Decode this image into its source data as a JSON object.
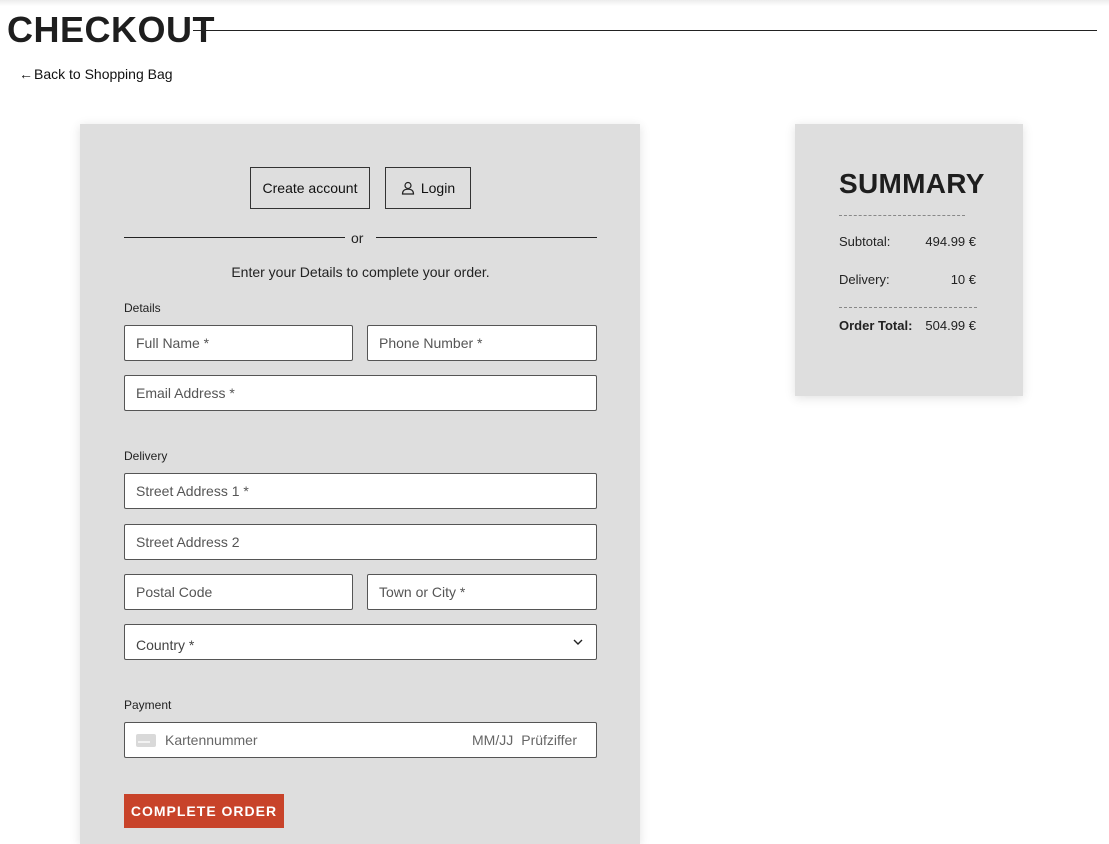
{
  "page": {
    "title": "CHECKOUT",
    "back_link": "Back to Shopping Bag",
    "back_arrow": "←"
  },
  "auth": {
    "create_account": "Create account",
    "login": "Login",
    "or": "or"
  },
  "form": {
    "intro": "Enter your Details to complete your order.",
    "details_label": "Details",
    "full_name_ph": "Full Name *",
    "phone_ph": "Phone Number *",
    "email_ph": "Email Address *",
    "delivery_label": "Delivery",
    "street1_ph": "Street Address 1 *",
    "street2_ph": "Street Address 2",
    "postal_ph": "Postal Code",
    "town_ph": "Town or City *",
    "country_value": "Country *",
    "payment_label": "Payment",
    "card_number_ph": "Kartennummer",
    "card_expiry_ph": "MM/JJ",
    "card_cvc_ph": "Prüfziffer",
    "complete_button": "COMPLETE ORDER"
  },
  "summary": {
    "title": "SUMMARY",
    "subtotal_label": "Subtotal:",
    "subtotal_value": "494.99 €",
    "delivery_label": "Delivery:",
    "delivery_value": "10 €",
    "total_label": "Order Total:",
    "total_value": "504.99 €"
  },
  "icons": {
    "user": "user-icon",
    "chevron": "chevron-down-icon",
    "card": "credit-card-icon"
  },
  "colors": {
    "accent": "#c8432a",
    "card_bg": "#dedede"
  }
}
